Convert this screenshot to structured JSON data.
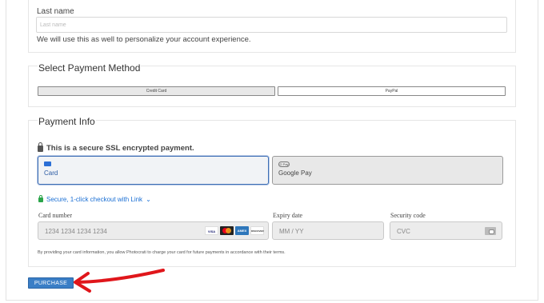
{
  "account": {
    "last_name_label": "Last name",
    "last_name_placeholder": "Last name",
    "help_text": "We will use this as well to personalize your account experience."
  },
  "payment_method": {
    "title": "Select Payment Method",
    "options": [
      "Credit Card",
      "PayPal"
    ]
  },
  "payment_info": {
    "title": "Payment Info",
    "secure_text": "This is a secure SSL encrypted payment.",
    "tabs": [
      "Card",
      "Google Pay"
    ],
    "gpay_badge": "G Pay",
    "link_text": "Secure, 1-click checkout with Link",
    "card_number_label": "Card number",
    "card_number_placeholder": "1234 1234 1234 1234",
    "expiry_label": "Expiry date",
    "expiry_placeholder": "MM / YY",
    "security_label": "Security code",
    "security_placeholder": "CVC",
    "brands": [
      "VISA",
      "MC",
      "AMEX",
      "DISCOVER"
    ],
    "terms": "By providing your card information, you allow Photocrati to charge your card for future payments in accordance with their terms."
  },
  "purchase_label": "PURCHASE",
  "colors": {
    "accent": "#3a7ec6",
    "link": "#1a6fd4",
    "arrow": "#e0161b",
    "secure_green": "#2ba54a"
  }
}
